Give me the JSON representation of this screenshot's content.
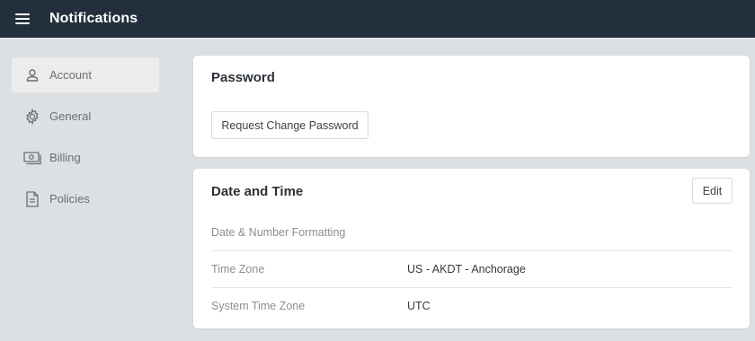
{
  "header": {
    "title": "Notifications",
    "menu_icon": "hamburger-menu-icon"
  },
  "sidebar": {
    "items": [
      {
        "label": "Account",
        "icon": "user-icon",
        "active": true
      },
      {
        "label": "General",
        "icon": "gear-icon",
        "active": false
      },
      {
        "label": "Billing",
        "icon": "money-icon",
        "active": false
      },
      {
        "label": "Policies",
        "icon": "document-icon",
        "active": false
      }
    ]
  },
  "password_card": {
    "title": "Password",
    "request_button": "Request Change Password"
  },
  "datetime_card": {
    "title": "Date and Time",
    "edit_button": "Edit",
    "rows": [
      {
        "label": "Date & Number Formatting",
        "value": ""
      },
      {
        "label": "Time Zone",
        "value": "US - AKDT - Anchorage"
      },
      {
        "label": "System Time Zone",
        "value": "UTC"
      }
    ]
  },
  "colors": {
    "topbar": "#232f3c",
    "background": "#dde0e2",
    "card": "#ffffff",
    "active_item": "#ececec"
  }
}
